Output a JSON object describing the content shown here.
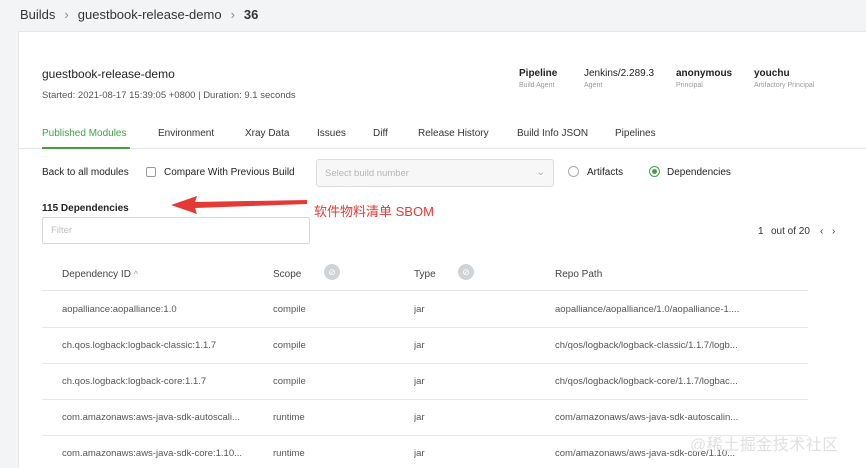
{
  "breadcrumb": {
    "items": [
      "Builds",
      "guestbook-release-demo",
      "36"
    ]
  },
  "build": {
    "name": "guestbook-release-demo",
    "meta": "Started: 2021-08-17 15:39:05 +0800 | Duration: 9.1 seconds"
  },
  "info": [
    {
      "value": "Pipeline",
      "label": "Build Agent"
    },
    {
      "value": "Jenkins/2.289.3",
      "label": "Agent"
    },
    {
      "value": "anonymous",
      "label": "Principal"
    },
    {
      "value": "youchu",
      "label": "Artifactory Principal"
    }
  ],
  "tabs": [
    "Published Modules",
    "Environment",
    "Xray Data",
    "Issues",
    "Diff",
    "Release History",
    "Build Info JSON",
    "Pipelines"
  ],
  "controls": {
    "back": "Back to all modules",
    "compare": "Compare With Previous Build",
    "select_placeholder": "Select build number",
    "radio_artifacts": "Artifacts",
    "radio_dependencies": "Dependencies",
    "selected_radio": "Dependencies"
  },
  "count": "115 Dependencies",
  "filter_placeholder": "Filter",
  "pager": {
    "current": "1",
    "total": "out of 20"
  },
  "annotation": "软件物料清单 SBOM",
  "table": {
    "headers": [
      "Dependency ID",
      "Scope",
      "Type",
      "Repo Path"
    ],
    "rows": [
      [
        "aopalliance:aopalliance:1.0",
        "compile",
        "jar",
        "aopalliance/aopalliance/1.0/aopalliance-1...."
      ],
      [
        "ch.qos.logback:logback-classic:1.1.7",
        "compile",
        "jar",
        "ch/qos/logback/logback-classic/1.1.7/logb..."
      ],
      [
        "ch.qos.logback:logback-core:1.1.7",
        "compile",
        "jar",
        "ch/qos/logback/logback-core/1.1.7/logbac..."
      ],
      [
        "com.amazonaws:aws-java-sdk-autoscali...",
        "runtime",
        "jar",
        "com/amazonaws/aws-java-sdk-autoscalin..."
      ],
      [
        "com.amazonaws:aws-java-sdk-core:1.10...",
        "runtime",
        "jar",
        "com/amazonaws/aws-java-sdk-core/1.10..."
      ]
    ]
  },
  "watermark": "@稀土掘金技术社区",
  "colors": {
    "accent": "#43a047",
    "annotation": "#e53935"
  }
}
